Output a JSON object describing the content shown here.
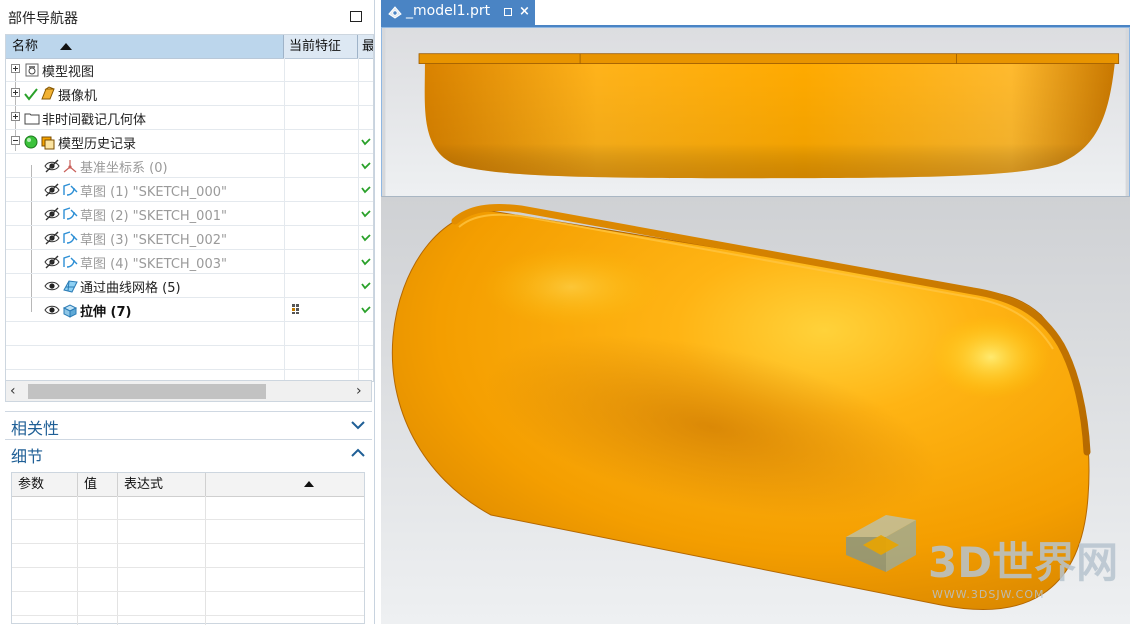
{
  "navigator": {
    "title": "部件导航器",
    "columns": {
      "name": "名称",
      "current_feature": "当前特征",
      "extra": "最"
    },
    "tree": [
      {
        "label": "模型视图",
        "icon": "model-views-icon",
        "indent": 0,
        "expander": "plus",
        "style": "normal"
      },
      {
        "label": "摄像机",
        "icon": "camera-icon",
        "indent": 0,
        "expander": "plus",
        "style": "normal"
      },
      {
        "label": "非时间戳记几何体",
        "icon": "folder-icon",
        "indent": 0,
        "expander": "plus",
        "style": "normal"
      },
      {
        "label": "模型历史记录",
        "icon": "model-history-icon",
        "indent": 0,
        "expander": "minus",
        "style": "normal",
        "check": true
      },
      {
        "label": "基准坐标系 (0)",
        "icon": "datum-csys-icon",
        "indent": 1,
        "style": "dim",
        "check": true
      },
      {
        "label": "草图 (1) \"SKETCH_000\"",
        "icon": "sketch-icon",
        "indent": 1,
        "style": "dim",
        "check": true
      },
      {
        "label": "草图 (2) \"SKETCH_001\"",
        "icon": "sketch-icon",
        "indent": 1,
        "style": "dim",
        "check": true
      },
      {
        "label": "草图 (3) \"SKETCH_002\"",
        "icon": "sketch-icon",
        "indent": 1,
        "style": "dim",
        "check": true
      },
      {
        "label": "草图 (4) \"SKETCH_003\"",
        "icon": "sketch-icon",
        "indent": 1,
        "style": "dim",
        "check": true
      },
      {
        "label": "通过曲线网格 (5)",
        "icon": "through-curve-mesh-icon",
        "indent": 1,
        "style": "normal",
        "check": true
      },
      {
        "label": "拉伸 (7)",
        "icon": "extrude-icon",
        "indent": 1,
        "style": "bold",
        "check": true,
        "current": true
      }
    ]
  },
  "sections": {
    "dependencies": "相关性",
    "details": "细节"
  },
  "details_table": {
    "columns": [
      "参数",
      "值",
      "表达式"
    ]
  },
  "viewport": {
    "tab_label": "_model1.prt",
    "tab_close": "×",
    "accent": "#4a84c4",
    "model_color": "#f5a300"
  },
  "watermark": {
    "main": "3D世界网",
    "sub": "WWW.3DSJW.COM"
  }
}
